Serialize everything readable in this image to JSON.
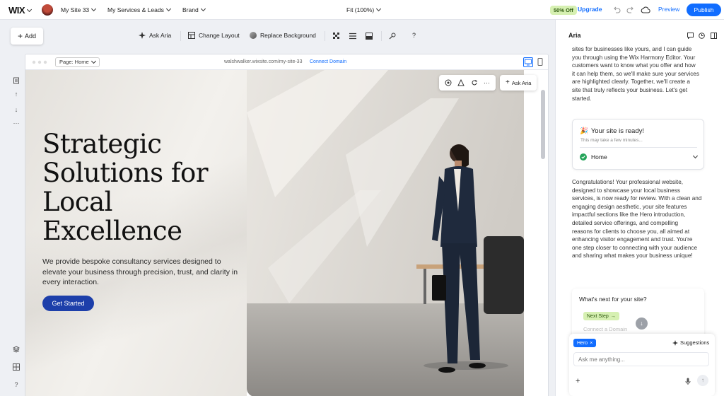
{
  "topbar": {
    "logo": "WIX",
    "site_menu": "My Site 33",
    "services_menu": "My Services & Leads",
    "brand_menu": "Brand",
    "zoom": "Fit (100%)",
    "discount_badge": "50% Off",
    "upgrade": "Upgrade",
    "preview": "Preview",
    "publish": "Publish"
  },
  "toolbar": {
    "add": "Add",
    "ask_aria": "Ask Aria",
    "change_layout": "Change Layout",
    "replace_background": "Replace Background"
  },
  "canvas": {
    "page_selector": "Page: Home",
    "url": "walshwalker.wixsite.com/my-site-33",
    "connect_domain": "Connect Domain",
    "ask_aria_button": "Ask Aria",
    "hero": {
      "heading_lines": [
        "Strategic",
        "Solutions for",
        "Local",
        "Excellence"
      ],
      "subtext": "We provide bespoke consultancy services designed to elevate your business through precision, trust, and clarity in every interaction.",
      "cta": "Get Started"
    }
  },
  "panel": {
    "title": "Aria",
    "intro_lines": [
      "sites for businesses like yours, and I can guide",
      "you through using the Wix Harmony Editor. Your",
      "customers want to know what you offer and how",
      "it can help them, so we'll make sure your services",
      "are highlighted clearly. Together, we'll create a",
      "site that truly reflects your business. Let's get",
      "started."
    ],
    "ready_card": {
      "title": "Your site is ready!",
      "subtitle": "This may take a few minutes...",
      "page": "Home"
    },
    "congrats_lines": [
      "Congratulations! Your professional website,",
      "designed to showcase your local business",
      "services, is now ready for review. With a clean and",
      "engaging design aesthetic, your site features",
      "impactful sections like the Hero introduction,",
      "detailed service offerings, and compelling",
      "reasons for clients to choose you, all aimed at",
      "enhancing visitor engagement and trust. You're",
      "one step closer to connecting with your audience",
      "and sharing what makes your business unique!"
    ],
    "next_card": {
      "title": "What's next for your site?",
      "next_step": "Next Step",
      "connect_domain": "Connect a Domain"
    },
    "composer": {
      "tag": "Hero",
      "suggestions": "Suggestions",
      "placeholder": "Ask me anything..."
    }
  },
  "colors": {
    "accent": "#116dff",
    "cta": "#1d3faa",
    "badge_bg": "#d6f0b2"
  }
}
